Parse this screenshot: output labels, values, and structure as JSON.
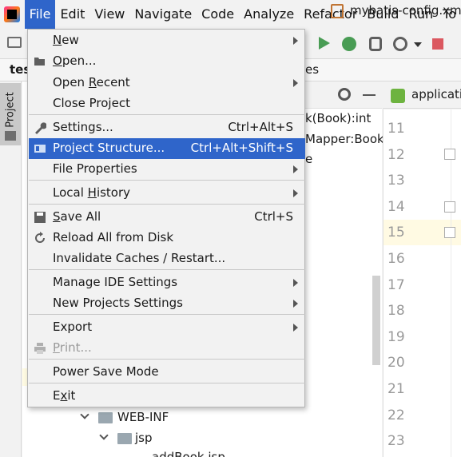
{
  "menubar": {
    "items": [
      "File",
      "Edit",
      "View",
      "Navigate",
      "Code",
      "Analyze",
      "Refactor",
      "Build",
      "Run",
      "To"
    ]
  },
  "navbar": {
    "project_short": "tes",
    "path_fragment": "es",
    "current_file": "mybatis-config.xml"
  },
  "project_tool": {
    "label": "Project"
  },
  "project_tree": {
    "visible_text": [
      "k(Book):int",
      "Mapper:Book",
      "e"
    ],
    "folders": [
      "WEB-INF",
      "jsp"
    ],
    "partial_file": "addBook.jsp"
  },
  "editor": {
    "tab_label": "applicatio",
    "line_numbers": [
      "11",
      "12",
      "13",
      "14",
      "15",
      "16",
      "17",
      "18",
      "19",
      "20",
      "21",
      "22",
      "23"
    ],
    "current_line": "15"
  },
  "file_menu": {
    "items": [
      {
        "label": "New",
        "mnemonic": "N",
        "submenu": true
      },
      {
        "label": "Open...",
        "mnemonic": "O",
        "icon": "folder-open-icon"
      },
      {
        "label": "Open Recent",
        "mnemonic": "R",
        "submenu": true
      },
      {
        "label": "Close Project"
      },
      {
        "label": "Settings...",
        "shortcut": "Ctrl+Alt+S",
        "icon": "wrench-icon"
      },
      {
        "label": "Project Structure...",
        "shortcut": "Ctrl+Alt+Shift+S",
        "icon": "project-structure-icon",
        "selected": true
      },
      {
        "label": "File Properties",
        "submenu": true
      },
      {
        "label": "Local History",
        "mnemonic": "H",
        "submenu": true
      },
      {
        "label": "Save All",
        "mnemonic": "S",
        "shortcut": "Ctrl+S",
        "icon": "save-icon"
      },
      {
        "label": "Reload All from Disk",
        "icon": "reload-icon"
      },
      {
        "label": "Invalidate Caches / Restart..."
      },
      {
        "label": "Manage IDE Settings",
        "submenu": true
      },
      {
        "label": "New Projects Settings",
        "submenu": true
      },
      {
        "label": "Export",
        "submenu": true
      },
      {
        "label": "Print...",
        "mnemonic": "P",
        "disabled": true,
        "icon": "print-icon"
      },
      {
        "label": "Power Save Mode"
      },
      {
        "label": "Exit",
        "mnemonic": "x"
      }
    ]
  },
  "colors": {
    "selection": "#2f65ca",
    "menu_bg": "#f2f2f2",
    "run_green": "#499c54",
    "stop_red": "#db5860"
  }
}
